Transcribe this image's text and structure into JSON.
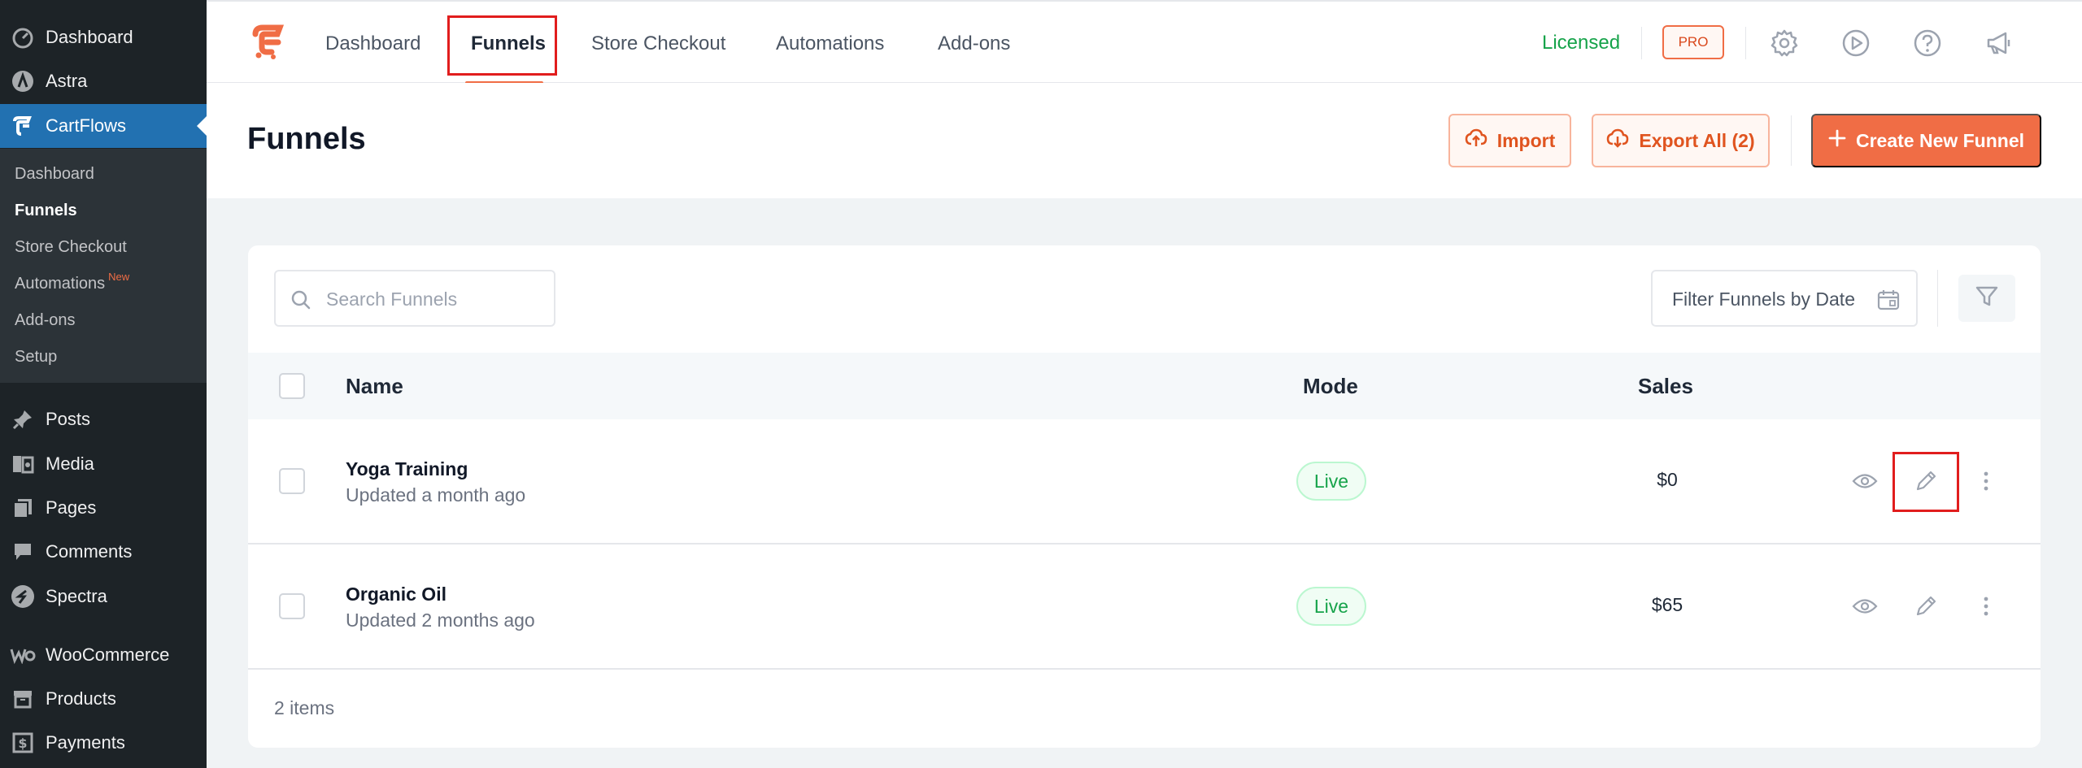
{
  "wp_menu": {
    "top_items": [
      {
        "label": "Dashboard",
        "icon": "dashboard-icon"
      },
      {
        "label": "Astra",
        "icon": "astra-icon"
      },
      {
        "label": "CartFlows",
        "icon": "cartflows-icon"
      }
    ],
    "submenu": [
      {
        "label": "Dashboard"
      },
      {
        "label": "Funnels"
      },
      {
        "label": "Store Checkout"
      },
      {
        "label": "Automations",
        "badge": "New"
      },
      {
        "label": "Add-ons"
      },
      {
        "label": "Setup"
      }
    ],
    "bottom_items": [
      {
        "label": "Posts",
        "icon": "pushpin-icon"
      },
      {
        "label": "Media",
        "icon": "media-icon"
      },
      {
        "label": "Pages",
        "icon": "pages-icon"
      },
      {
        "label": "Comments",
        "icon": "comment-icon"
      },
      {
        "label": "Spectra",
        "icon": "spectra-icon"
      },
      {
        "label": "WooCommerce",
        "icon": "woocommerce-icon"
      },
      {
        "label": "Products",
        "icon": "archive-icon"
      },
      {
        "label": "Payments",
        "icon": "dollar-icon"
      }
    ]
  },
  "topnav": {
    "links": [
      "Dashboard",
      "Funnels",
      "Store Checkout",
      "Automations",
      "Add-ons"
    ],
    "active": "Funnels",
    "licensed": "Licensed",
    "pro_badge": "PRO",
    "icons": [
      "gear-icon",
      "play-icon",
      "help-icon",
      "megaphone-icon"
    ]
  },
  "page": {
    "title": "Funnels",
    "import_label": "Import",
    "export_label": "Export All (2)",
    "create_label": "Create New Funnel"
  },
  "filters": {
    "search_placeholder": "Search Funnels",
    "date_filter_label": "Filter Funnels by Date"
  },
  "table": {
    "headers": {
      "name": "Name",
      "mode": "Mode",
      "sales": "Sales"
    },
    "rows": [
      {
        "name": "Yoga Training",
        "updated": "Updated a month ago",
        "mode": "Live",
        "sales": "$0"
      },
      {
        "name": "Organic Oil",
        "updated": "Updated 2 months ago",
        "mode": "Live",
        "sales": "$65"
      }
    ],
    "footer": "2 items"
  },
  "colors": {
    "accent": "#f06d45",
    "wp_sidebar": "#1d2327",
    "wp_active": "#2271b1",
    "live_green": "#16a34a",
    "highlight_red": "#e11d1d"
  }
}
